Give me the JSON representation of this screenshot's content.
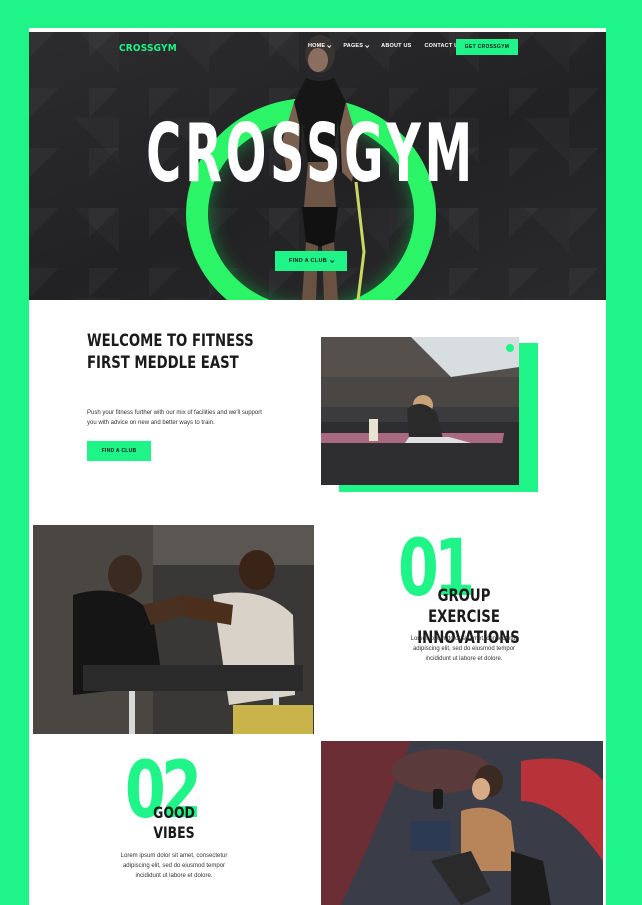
{
  "header": {
    "brand": "CROSSGYM",
    "nav": [
      {
        "label": "HOME",
        "dropdown": true
      },
      {
        "label": "PAGES",
        "dropdown": true
      },
      {
        "label": "ABOUT US",
        "dropdown": false
      },
      {
        "label": "CONTACT US",
        "dropdown": false
      }
    ],
    "cta_label": "GET CROSSGYM"
  },
  "hero": {
    "title": "CROSSGYM",
    "button_label": "FIND A CLUB"
  },
  "welcome": {
    "title_line1": "WELCOME TO FITNESS",
    "title_line2": "FIRST MEDDLE EAST",
    "text": "Push your fitness further with our mix of facilities and we'll support you with advice on new and better ways to train.",
    "button_label": "FIND A CLUB"
  },
  "features": [
    {
      "number": "01",
      "title_line1": "GROUP EXERCISE",
      "title_line2": "INNOVATIONS",
      "text": "Lorem ipsum dolor sit amet, consectetur adipiscing elit, sed do eiusmod tempor incididunt ut labore et dolore."
    },
    {
      "number": "02",
      "title_line1": "GOOD",
      "title_line2": "VIBES",
      "text": "Lorem ipsum dolor sit amet, consectetur adipiscing elit, sed do eiusmod tempor incididunt ut labore et dolore."
    }
  ],
  "colors": {
    "accent": "#1ef488",
    "dark": "#2a2a2c",
    "text": "#1a1a1a"
  },
  "icons": [
    "chevron-down-icon"
  ]
}
